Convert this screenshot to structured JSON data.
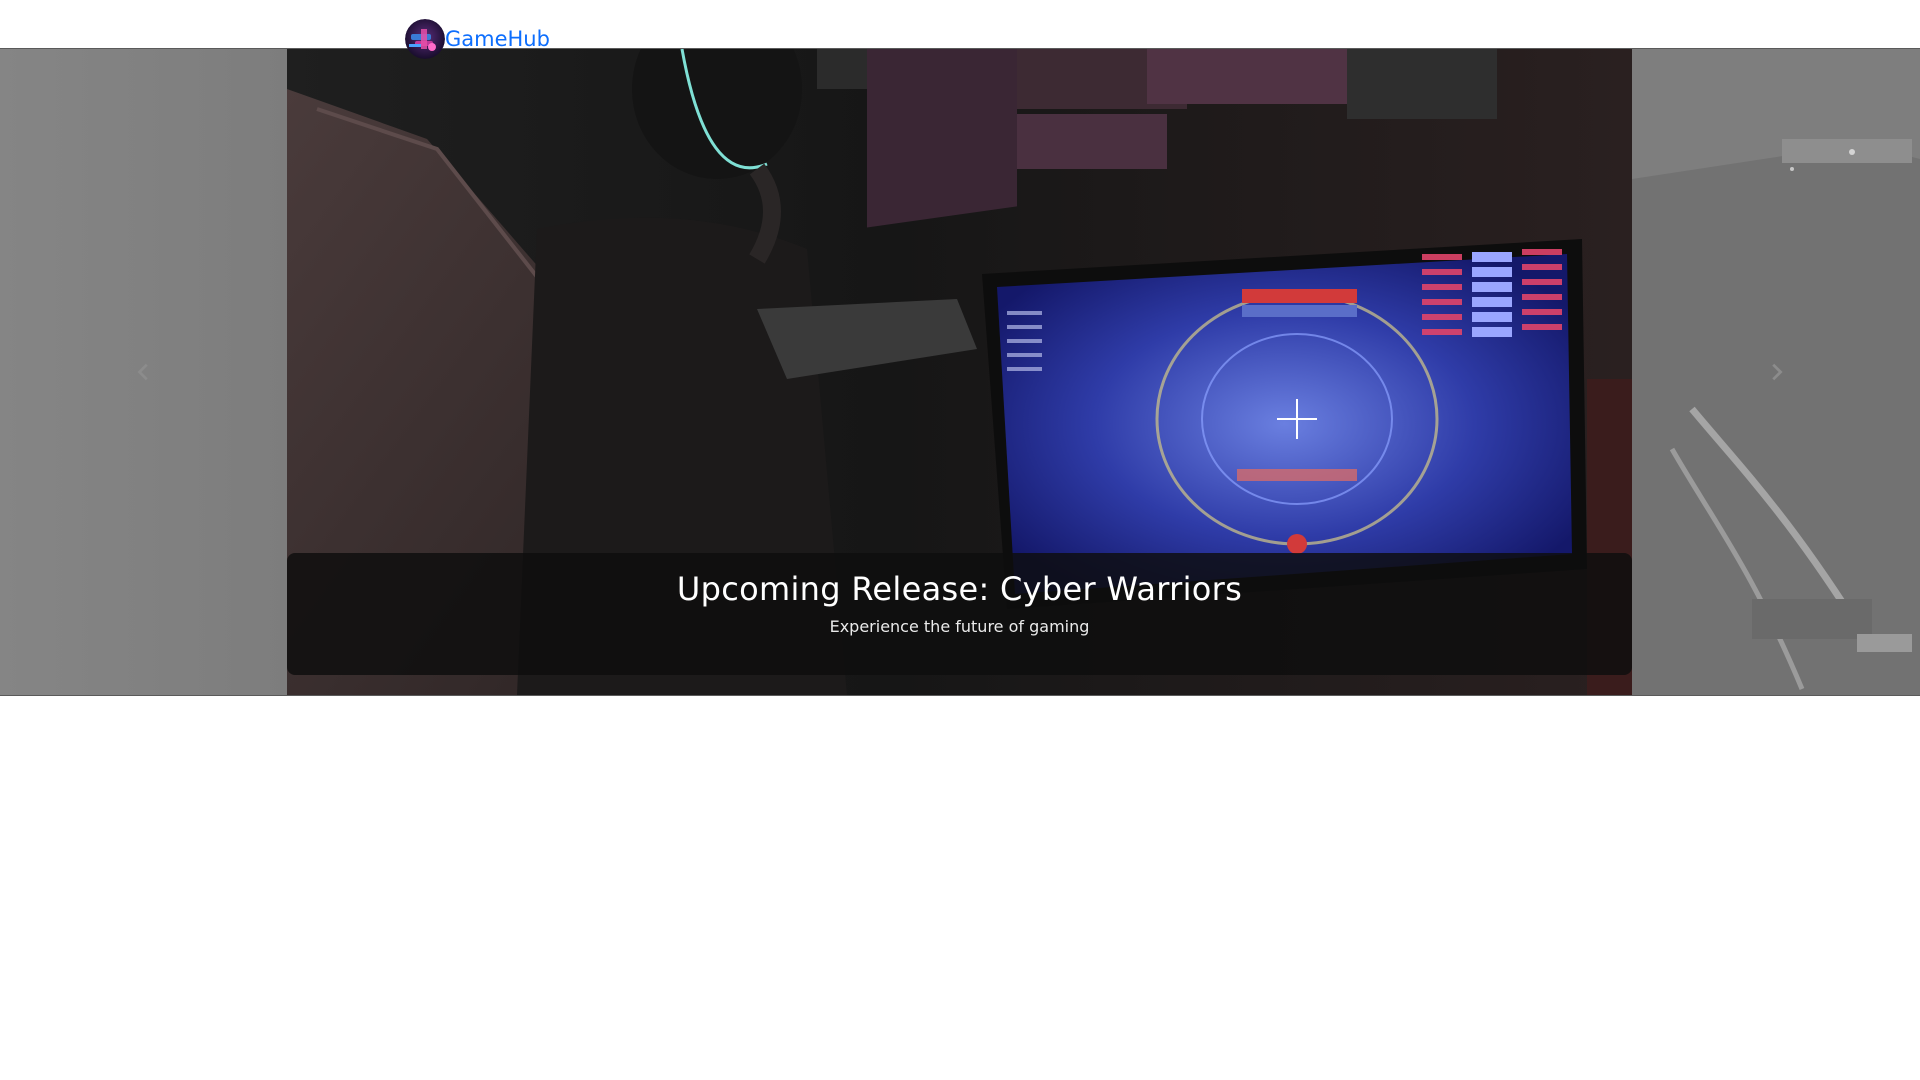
{
  "navbar": {
    "brand_name": "GameHub",
    "brand_color": "#0d6efd",
    "logo_icon": "gamehub-logo-icon"
  },
  "carousel": {
    "slide_title": "Upcoming Release: Cyber Warriors",
    "slide_subtitle": "Experience the future of gaming",
    "prev_icon": "chevron-left-icon",
    "next_icon": "chevron-right-icon"
  }
}
